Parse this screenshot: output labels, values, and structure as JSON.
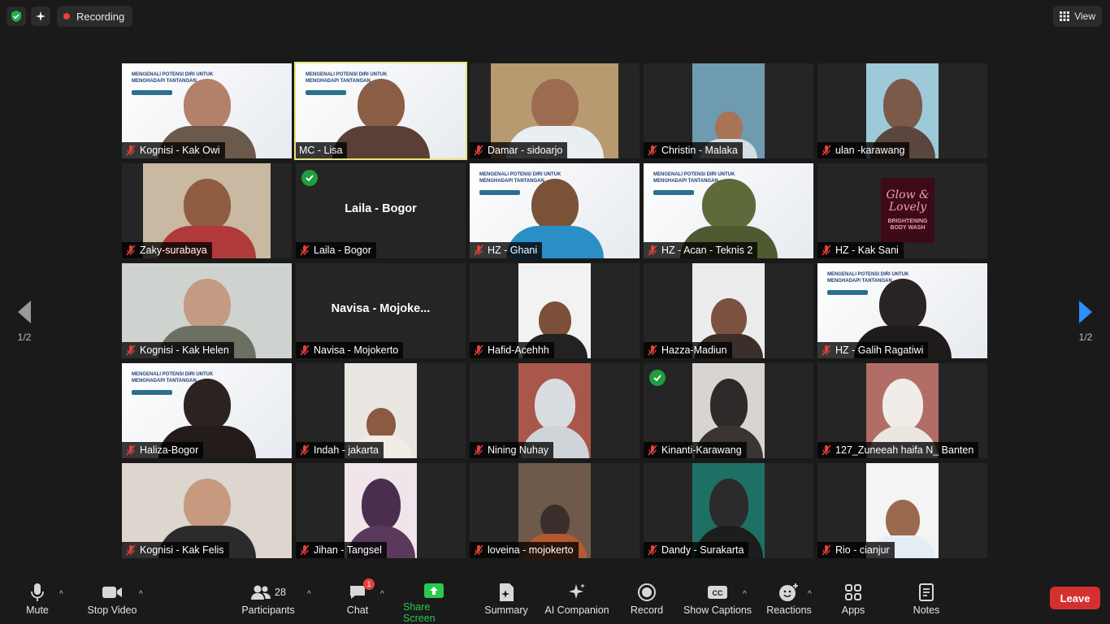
{
  "topbar": {
    "recording_label": "Recording",
    "view_label": "View"
  },
  "pagination": {
    "left": "1/2",
    "right": "1/2"
  },
  "participants": [
    {
      "name": "Kognisi - Kak Owi",
      "muted": true,
      "speaker": false,
      "check": false
    },
    {
      "name": "MC - Lisa",
      "muted": false,
      "speaker": true,
      "check": false
    },
    {
      "name": "Damar - sidoarjo",
      "muted": true,
      "speaker": false,
      "check": false
    },
    {
      "name": "Christin - Malaka",
      "muted": true,
      "speaker": false,
      "check": false
    },
    {
      "name": "ulan -karawang",
      "muted": true,
      "speaker": false,
      "check": false
    },
    {
      "name": "Zaky-surabaya",
      "muted": true,
      "speaker": false,
      "check": false
    },
    {
      "name": "Laila - Bogor",
      "muted": true,
      "speaker": false,
      "check": true,
      "video_off_name": "Laila - Bogor"
    },
    {
      "name": "HZ - Ghani",
      "muted": true,
      "speaker": false,
      "check": false
    },
    {
      "name": "HZ - Acan - Teknis 2",
      "muted": true,
      "speaker": false,
      "check": false
    },
    {
      "name": "HZ - Kak Sani",
      "muted": true,
      "speaker": false,
      "check": false
    },
    {
      "name": "Kognisi - Kak Helen",
      "muted": true,
      "speaker": false,
      "check": false
    },
    {
      "name": "Navisa - Mojokerto",
      "muted": true,
      "speaker": false,
      "check": false,
      "video_off_name": "Navisa  -  Mojoke..."
    },
    {
      "name": "Hafid-Acehhh",
      "muted": true,
      "speaker": false,
      "check": false
    },
    {
      "name": "Hazza-Madiun",
      "muted": true,
      "speaker": false,
      "check": false
    },
    {
      "name": "HZ - Galih Ragatiwi",
      "muted": true,
      "speaker": false,
      "check": false
    },
    {
      "name": "Haliza-Bogor",
      "muted": true,
      "speaker": false,
      "check": false
    },
    {
      "name": "Indah - jakarta",
      "muted": true,
      "speaker": false,
      "check": false
    },
    {
      "name": "Nining Nuhay",
      "muted": true,
      "speaker": false,
      "check": false
    },
    {
      "name": "Kinanti-Karawang",
      "muted": true,
      "speaker": false,
      "check": true
    },
    {
      "name": "127_Zuneeah haifa N_ Banten",
      "muted": true,
      "speaker": false,
      "check": false
    },
    {
      "name": "Kognisi - Kak Felis",
      "muted": true,
      "speaker": false,
      "check": false
    },
    {
      "name": "Jihan - Tangsel",
      "muted": true,
      "speaker": false,
      "check": false
    },
    {
      "name": "loveina - mojokerto",
      "muted": true,
      "speaker": false,
      "check": false
    },
    {
      "name": "Dandy - Surakarta",
      "muted": true,
      "speaker": false,
      "check": false
    },
    {
      "name": "Rio  - cianjur",
      "muted": true,
      "speaker": false,
      "check": false
    }
  ],
  "slide": {
    "title_line1": "MENGENALI POTENSI DIRI UNTUK",
    "title_line2": "MENGHADAPI TANTANGAN"
  },
  "brand_tile": {
    "brand": "Glow & Lovely",
    "subtitle": "BRIGHTENING BODY WASH"
  },
  "toolbar": {
    "mute": "Mute",
    "stop_video": "Stop Video",
    "participants": "Participants",
    "participants_count": "28",
    "chat": "Chat",
    "chat_badge": "1",
    "share_screen": "Share Screen",
    "summary": "Summary",
    "ai_companion": "AI Companion",
    "record": "Record",
    "show_captions": "Show Captions",
    "reactions": "Reactions",
    "apps": "Apps",
    "notes": "Notes",
    "leave": "Leave"
  },
  "colors": {
    "background": "#1a1a1a",
    "tile": "#252525",
    "speaker_outline": "#e8e37a",
    "muted_icon": "#e5413a",
    "share_green": "#2cc84f",
    "leave_red": "#d3302f"
  }
}
